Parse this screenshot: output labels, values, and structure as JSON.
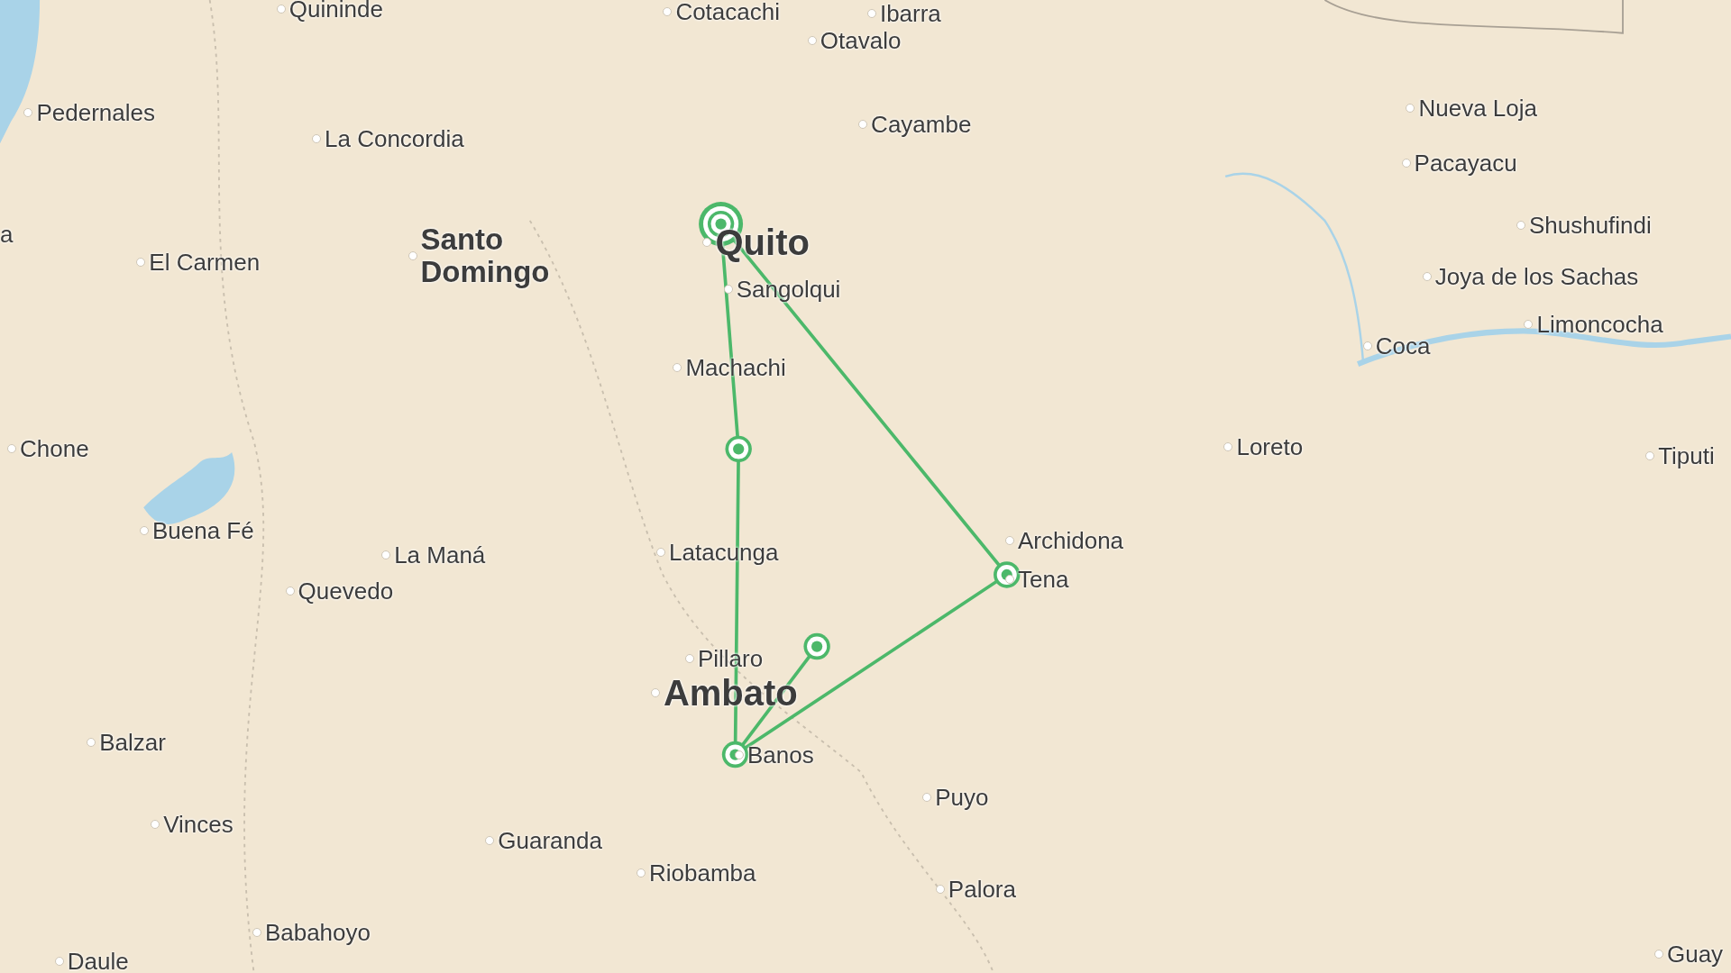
{
  "map": {
    "places": [
      {
        "name": "Quininde",
        "kind": "town"
      },
      {
        "name": "Cotacachi",
        "kind": "town"
      },
      {
        "name": "Ibarra",
        "kind": "town"
      },
      {
        "name": "Otavalo",
        "kind": "town"
      },
      {
        "name": "Pedernales",
        "kind": "town"
      },
      {
        "name": "La Concordia",
        "kind": "town"
      },
      {
        "name": "Cayambe",
        "kind": "town"
      },
      {
        "name": "Nueva Loja",
        "kind": "town"
      },
      {
        "name": "Pacayacu",
        "kind": "town"
      },
      {
        "name": "Shushufindi",
        "kind": "town"
      },
      {
        "name": "a",
        "kind": "town"
      },
      {
        "name": "El Carmen",
        "kind": "town"
      },
      {
        "name": "Santo Domingo",
        "kind": "city"
      },
      {
        "name": "Quito",
        "kind": "capital"
      },
      {
        "name": "Joya de los Sachas",
        "kind": "town"
      },
      {
        "name": "Sangolqui",
        "kind": "town"
      },
      {
        "name": "Limoncocha",
        "kind": "town"
      },
      {
        "name": "Coca",
        "kind": "town"
      },
      {
        "name": "Machachi",
        "kind": "town"
      },
      {
        "name": "Chone",
        "kind": "town"
      },
      {
        "name": "Loreto",
        "kind": "town"
      },
      {
        "name": "Tiputi",
        "kind": "town"
      },
      {
        "name": "Buena Fé",
        "kind": "town"
      },
      {
        "name": "Archidona",
        "kind": "town"
      },
      {
        "name": "La Maná",
        "kind": "town"
      },
      {
        "name": "Latacunga",
        "kind": "town"
      },
      {
        "name": "Tena",
        "kind": "town"
      },
      {
        "name": "Quevedo",
        "kind": "town"
      },
      {
        "name": "Pillaro",
        "kind": "town"
      },
      {
        "name": "Ambato",
        "kind": "capital"
      },
      {
        "name": "Balzar",
        "kind": "town"
      },
      {
        "name": "Banos",
        "kind": "town"
      },
      {
        "name": "Puyo",
        "kind": "town"
      },
      {
        "name": "Vinces",
        "kind": "town"
      },
      {
        "name": "Guaranda",
        "kind": "town"
      },
      {
        "name": "Riobamba",
        "kind": "town"
      },
      {
        "name": "Palora",
        "kind": "town"
      },
      {
        "name": "Babahoyo",
        "kind": "town"
      },
      {
        "name": "Daule",
        "kind": "town"
      },
      {
        "name": "Guay",
        "kind": "town"
      }
    ]
  }
}
